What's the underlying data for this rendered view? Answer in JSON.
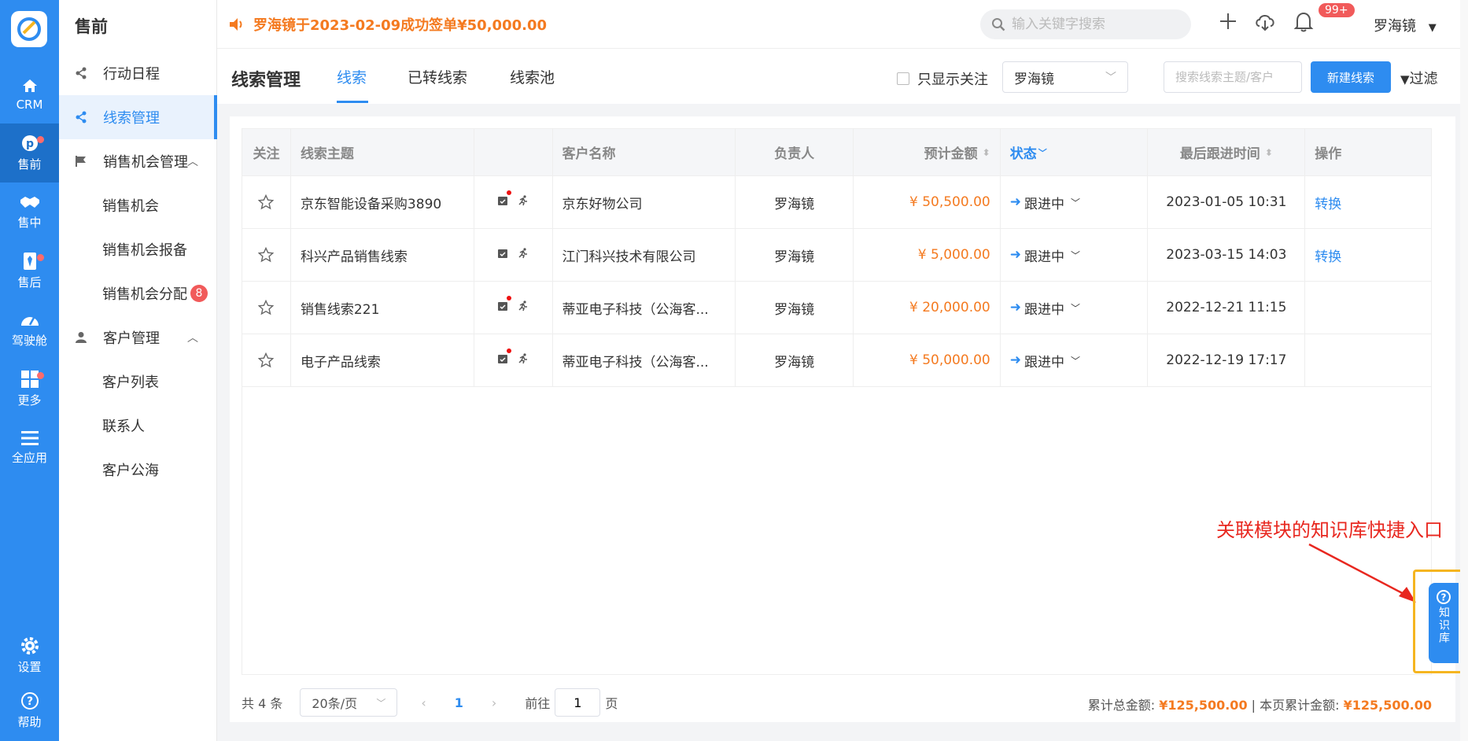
{
  "rail": {
    "items": [
      {
        "label": "CRM",
        "icon": "home-icon"
      },
      {
        "label": "售前",
        "icon": "pinterest-icon",
        "dot": true
      },
      {
        "label": "售中",
        "icon": "handshake-icon"
      },
      {
        "label": "售后",
        "icon": "tie-icon",
        "dot": true
      },
      {
        "label": "驾驶舱",
        "icon": "dashboard-icon"
      },
      {
        "label": "更多",
        "icon": "grid-icon",
        "dot": true
      },
      {
        "label": "全应用",
        "icon": "menu-icon"
      },
      {
        "label": "设置",
        "icon": "gear-icon"
      },
      {
        "label": "帮助",
        "icon": "help-icon"
      }
    ]
  },
  "sidebar": {
    "title": "售前",
    "items": [
      {
        "label": "行动日程"
      },
      {
        "label": "线索管理"
      },
      {
        "label": "销售机会管理"
      },
      {
        "label": "销售机会"
      },
      {
        "label": "销售机会报备"
      },
      {
        "label": "销售机会分配",
        "badge": "8"
      },
      {
        "label": "客户管理"
      },
      {
        "label": "客户列表"
      },
      {
        "label": "联系人"
      },
      {
        "label": "客户公海"
      }
    ]
  },
  "topbar": {
    "notice": "罗海镜于2023-02-09成功签单¥50,000.00",
    "search_placeholder": "输入关键字搜索",
    "notif_count": "99+",
    "user": "罗海镜"
  },
  "header": {
    "title": "线索管理",
    "tabs": [
      {
        "label": "线索"
      },
      {
        "label": "已转线索"
      },
      {
        "label": "线索池"
      }
    ],
    "only_follow": "只显示关注",
    "owner": "罗海镜",
    "search_placeholder": "搜索线索主题/客户",
    "new_button": "新建线索",
    "filter": "过滤"
  },
  "table": {
    "columns": {
      "follow": "关注",
      "subject": "线索主题",
      "icons": "",
      "customer": "客户名称",
      "owner": "负责人",
      "amount": "预计金额",
      "status": "状态",
      "last_time": "最后跟进时间",
      "action": "操作"
    },
    "rows": [
      {
        "subject": "京东智能设备采购3890",
        "customer": "京东好物公司",
        "owner": "罗海镜",
        "amount": "¥ 50,500.00",
        "status": "跟进中",
        "last_time": "2023-01-05 10:31",
        "action": "转换"
      },
      {
        "subject": "科兴产品销售线索",
        "customer": "江门科兴技术有限公司",
        "owner": "罗海镜",
        "amount": "¥ 5,000.00",
        "status": "跟进中",
        "last_time": "2023-03-15 14:03",
        "action": "转换"
      },
      {
        "subject": "销售线索221",
        "customer": "蒂亚电子科技（公海客...",
        "owner": "罗海镜",
        "amount": "¥ 20,000.00",
        "status": "跟进中",
        "last_time": "2022-12-21 11:15",
        "action": ""
      },
      {
        "subject": "电子产品线索",
        "customer": "蒂亚电子科技（公海客...",
        "owner": "罗海镜",
        "amount": "¥ 50,000.00",
        "status": "跟进中",
        "last_time": "2022-12-19 17:17",
        "action": ""
      }
    ]
  },
  "pager": {
    "total": "共 4 条",
    "page_size": "20条/页",
    "current": "1",
    "goto_label": "前往",
    "goto_value": "1",
    "page_suffix": "页"
  },
  "totals": {
    "label1": "累计总金额:",
    "value1": "¥125,500.00",
    "label2": "| 本页累计金额:",
    "value2": "¥125,500.00"
  },
  "annotation": "关联模块的知识库快捷入口",
  "kb_label": "知识库",
  "colors": {
    "primary": "#2e8cf0",
    "accent": "#f47a20",
    "annotation": "#e8271f",
    "highlight": "#f5b520"
  }
}
